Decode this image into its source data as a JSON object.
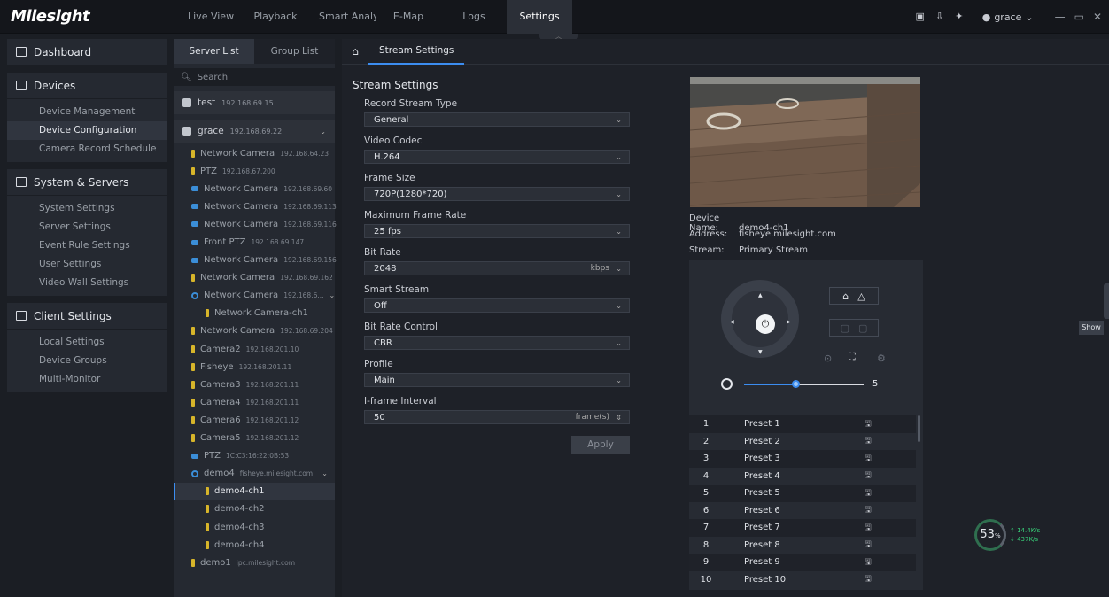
{
  "app": {
    "logo": "Milesight"
  },
  "nav": [
    "Live View",
    "Playback",
    "Smart Analytics",
    "E-Map",
    "Logs",
    "Settings"
  ],
  "user": {
    "name": "grace"
  },
  "sidebar": {
    "dashboard": "Dashboard",
    "devices": {
      "label": "Devices",
      "items": [
        "Device Management",
        "Device Configuration",
        "Camera Record Schedule"
      ]
    },
    "system": {
      "label": "System & Servers",
      "items": [
        "System Settings",
        "Server Settings",
        "Event Rule Settings",
        "User Settings",
        "Video Wall Settings"
      ]
    },
    "client": {
      "label": "Client Settings",
      "items": [
        "Local Settings",
        "Device Groups",
        "Multi-Monitor"
      ]
    }
  },
  "tree": {
    "tabs": [
      "Server List",
      "Group List"
    ],
    "search_placeholder": "Search",
    "servers": [
      {
        "name": "test",
        "ip": "192.168.69.15"
      },
      {
        "name": "grace",
        "ip": "192.168.69.22"
      }
    ],
    "rows": [
      {
        "name": "Network Camera",
        "ip": "192.168.64.23",
        "icon": "bullet"
      },
      {
        "name": "PTZ",
        "ip": "192.168.67.200",
        "icon": "bullet"
      },
      {
        "name": "Network Camera",
        "ip": "192.168.69.60",
        "icon": "blue"
      },
      {
        "name": "Network Camera",
        "ip": "192.168.69.113",
        "icon": "blue"
      },
      {
        "name": "Network Camera",
        "ip": "192.168.69.116",
        "icon": "blue"
      },
      {
        "name": "Front PTZ",
        "ip": "192.168.69.147",
        "icon": "blue"
      },
      {
        "name": "Network Camera",
        "ip": "192.168.69.156",
        "icon": "blue"
      },
      {
        "name": "Network Camera",
        "ip": "192.168.69.162",
        "icon": "bullet"
      },
      {
        "name": "Network Camera",
        "ip": "192.168.6...",
        "icon": "fish",
        "chev": true
      },
      {
        "name": "Network Camera-ch1",
        "ip": "",
        "icon": "bullet",
        "child": true
      },
      {
        "name": "Network Camera",
        "ip": "192.168.69.204",
        "icon": "bullet"
      },
      {
        "name": "Camera2",
        "ip": "192.168.201.10",
        "icon": "bullet"
      },
      {
        "name": "Fisheye",
        "ip": "192.168.201.11",
        "icon": "bullet"
      },
      {
        "name": "Camera3",
        "ip": "192.168.201.11",
        "icon": "bullet"
      },
      {
        "name": "Camera4",
        "ip": "192.168.201.11",
        "icon": "bullet"
      },
      {
        "name": "Camera6",
        "ip": "192.168.201.12",
        "icon": "bullet"
      },
      {
        "name": "Camera5",
        "ip": "192.168.201.12",
        "icon": "bullet"
      },
      {
        "name": "PTZ",
        "ip": "1C:C3:16:22:0B:53",
        "icon": "blue"
      },
      {
        "name": "demo4",
        "ip": "fisheye.milesight.com",
        "icon": "fish",
        "chev": true
      },
      {
        "name": "demo4-ch1",
        "ip": "",
        "icon": "bullet",
        "child": true,
        "selected": true
      },
      {
        "name": "demo4-ch2",
        "ip": "",
        "icon": "bullet",
        "child": true
      },
      {
        "name": "demo4-ch3",
        "ip": "",
        "icon": "bullet",
        "child": true
      },
      {
        "name": "demo4-ch4",
        "ip": "",
        "icon": "bullet",
        "child": true
      },
      {
        "name": "demo1",
        "ip": "ipc.milesight.com",
        "icon": "bullet"
      }
    ]
  },
  "main": {
    "tab": "Stream Settings",
    "title": "Stream Settings",
    "fields": [
      {
        "label": "Record Stream Type",
        "value": "General"
      },
      {
        "label": "Video Codec",
        "value": "H.264"
      },
      {
        "label": "Frame Size",
        "value": "720P(1280*720)"
      },
      {
        "label": "Maximum Frame Rate",
        "value": "25 fps"
      },
      {
        "label": "Bit Rate",
        "value": "2048",
        "unit": "kbps"
      },
      {
        "label": "Smart Stream",
        "value": "Off"
      },
      {
        "label": "Bit Rate Control",
        "value": "CBR"
      },
      {
        "label": "Profile",
        "value": "Main"
      },
      {
        "label": "I-frame Interval",
        "value": "50",
        "unit": "frame(s)",
        "spinner": true
      }
    ],
    "apply": "Apply",
    "device_info": [
      {
        "key": "Device Name:",
        "value": "demo4-ch1"
      },
      {
        "key": "Address:",
        "value": "fisheye.milesight.com"
      },
      {
        "key": "Stream:",
        "value": "Primary Stream"
      }
    ],
    "ptz": {
      "speed": "5",
      "speed_fraction": 0.44
    },
    "presets": [
      "Preset 1",
      "Preset 2",
      "Preset 3",
      "Preset 4",
      "Preset 5",
      "Preset 6",
      "Preset 7",
      "Preset 8",
      "Preset 9",
      "Preset 10"
    ],
    "show_button": "Show",
    "network": {
      "cpu": "53",
      "cpu_unit": "%",
      "up": "14.4",
      "up_unit": "K/s",
      "down": "437",
      "down_unit": "K/s"
    }
  },
  "colors": {
    "accent": "#3c8df0",
    "bg": "#1b1e24",
    "panel": "#252931"
  }
}
